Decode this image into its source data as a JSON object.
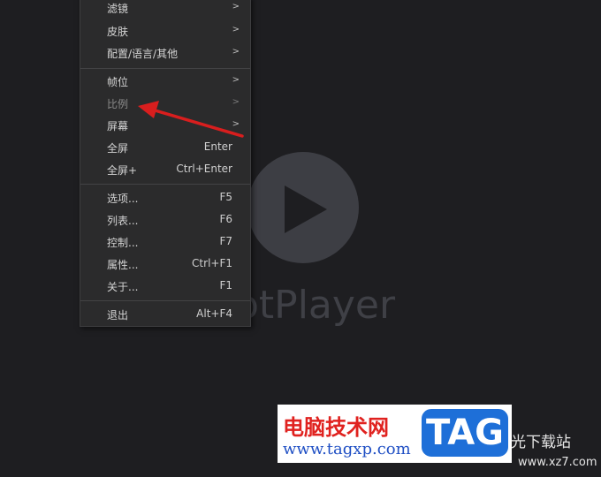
{
  "player": {
    "brand_fragment": "otPlayer"
  },
  "menu": {
    "items": [
      {
        "label": "滤镜",
        "shortcut": "",
        "submenu": true
      },
      {
        "label": "皮肤",
        "shortcut": "",
        "submenu": true
      },
      {
        "label": "配置/语言/其他",
        "shortcut": "",
        "submenu": true
      },
      {
        "label": "帧位",
        "shortcut": "",
        "submenu": true
      },
      {
        "label": "比例",
        "shortcut": "",
        "submenu": true
      },
      {
        "label": "屏幕",
        "shortcut": "",
        "submenu": true
      },
      {
        "label": "全屏",
        "shortcut": "Enter",
        "submenu": false
      },
      {
        "label": "全屏+",
        "shortcut": "Ctrl+Enter",
        "submenu": false
      },
      {
        "label": "选项...",
        "shortcut": "F5",
        "submenu": false
      },
      {
        "label": "列表...",
        "shortcut": "F6",
        "submenu": false
      },
      {
        "label": "控制...",
        "shortcut": "F7",
        "submenu": false
      },
      {
        "label": "属性...",
        "shortcut": "Ctrl+F1",
        "submenu": false
      },
      {
        "label": "关于...",
        "shortcut": "F1",
        "submenu": false
      },
      {
        "label": "退出",
        "shortcut": "Alt+F4",
        "submenu": false
      }
    ],
    "submenu_arrow": ">"
  },
  "watermark": {
    "site_name": "电脑技术网",
    "site_url": "www.tagxp.com",
    "tag": "TAG",
    "right_text": "光下载站",
    "right_url": "www.xz7.com"
  },
  "colors": {
    "background": "#1e1e21",
    "menu_bg": "#2b2b2c",
    "annotation_arrow": "#d81e1e",
    "tag_blue": "#1e6fd8"
  }
}
